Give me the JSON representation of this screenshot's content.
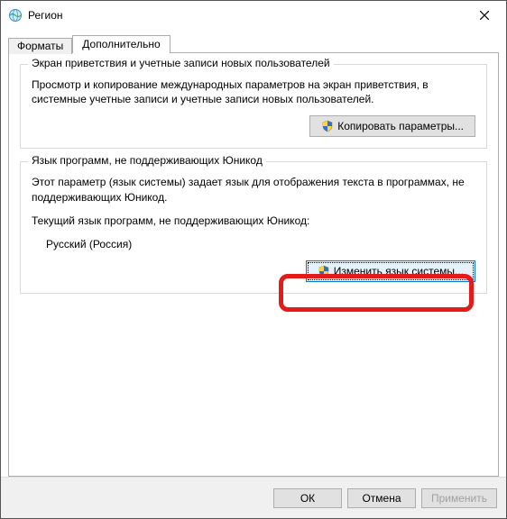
{
  "window": {
    "title": "Регион"
  },
  "tabs": {
    "formats": "Форматы",
    "advanced": "Дополнительно"
  },
  "group1": {
    "legend": "Экран приветствия и учетные записи новых пользователей",
    "desc": "Просмотр и копирование международных параметров на экран приветствия, в системные учетные записи и учетные записи новых пользователей.",
    "button": "Копировать параметры..."
  },
  "group2": {
    "legend": "Язык программ, не поддерживающих Юникод",
    "desc": "Этот параметр (язык системы) задает язык для отображения текста в программах, не поддерживающих Юникод.",
    "current_label": "Текущий язык программ, не поддерживающих Юникод:",
    "current_value": "Русский (Россия)",
    "button": "Изменить язык системы..."
  },
  "footer": {
    "ok": "ОК",
    "cancel": "Отмена",
    "apply": "Применить"
  }
}
